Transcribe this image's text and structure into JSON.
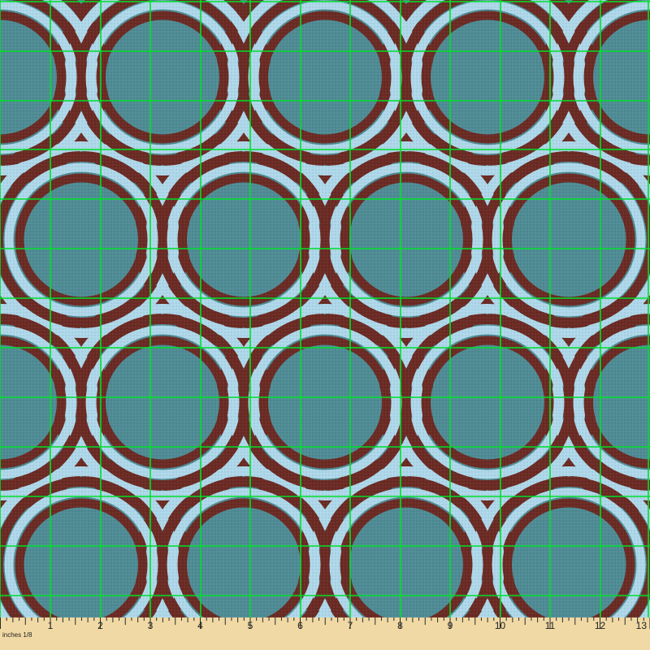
{
  "ruler": {
    "unit_label": "inches 1/8",
    "tick_labels": [
      "1",
      "2",
      "3",
      "4",
      "5",
      "6",
      "7",
      "8",
      "9",
      "10",
      "11",
      "12",
      "13"
    ]
  },
  "colors": {
    "background": "#4f8c95",
    "ring_dark": "#6b2b24",
    "ring_light": "#aed8ea",
    "grid_line": "#00e02a",
    "ruler_bg": "#f0d9a4",
    "ruler_ink": "#2a2a2a"
  }
}
